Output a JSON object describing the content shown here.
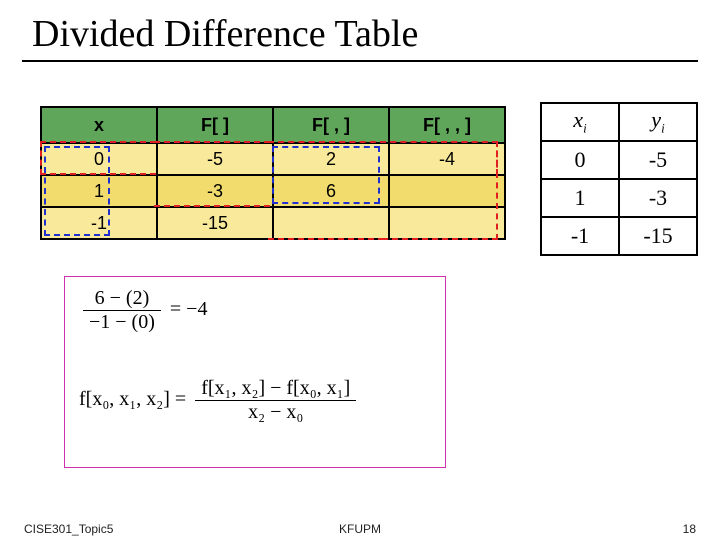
{
  "title": "Divided Difference Table",
  "dd_table": {
    "headers": [
      "x",
      "F[ ]",
      "F[ , ]",
      "F[ , , ]"
    ],
    "rows": [
      {
        "x": "0",
        "f": "-5",
        "f2": "2",
        "f3": "-4"
      },
      {
        "x": "1",
        "f": "-3",
        "f2": "6",
        "f3": ""
      },
      {
        "x": "-1",
        "f": "-15",
        "f2": "",
        "f3": ""
      }
    ]
  },
  "xy_table": {
    "headers": {
      "x": "x",
      "x_sub": "i",
      "y": "y",
      "y_sub": "i"
    },
    "rows": [
      {
        "x": "0",
        "y": "-5"
      },
      {
        "x": "1",
        "y": "-3"
      },
      {
        "x": "-1",
        "y": "-15"
      }
    ]
  },
  "formula1": {
    "num": "6 − (2)",
    "den": "−1 − (0)",
    "rhs": "= −4"
  },
  "formula2": {
    "lhs": "f[x",
    "lhs_full": "f[x₀, x₁, x₂] =",
    "num": "f[x₁, x₂] − f[x₀, x₁]",
    "den": "x₂ − x₀"
  },
  "footer": {
    "left": "CISE301_Topic5",
    "center": "KFUPM",
    "right": "18"
  }
}
